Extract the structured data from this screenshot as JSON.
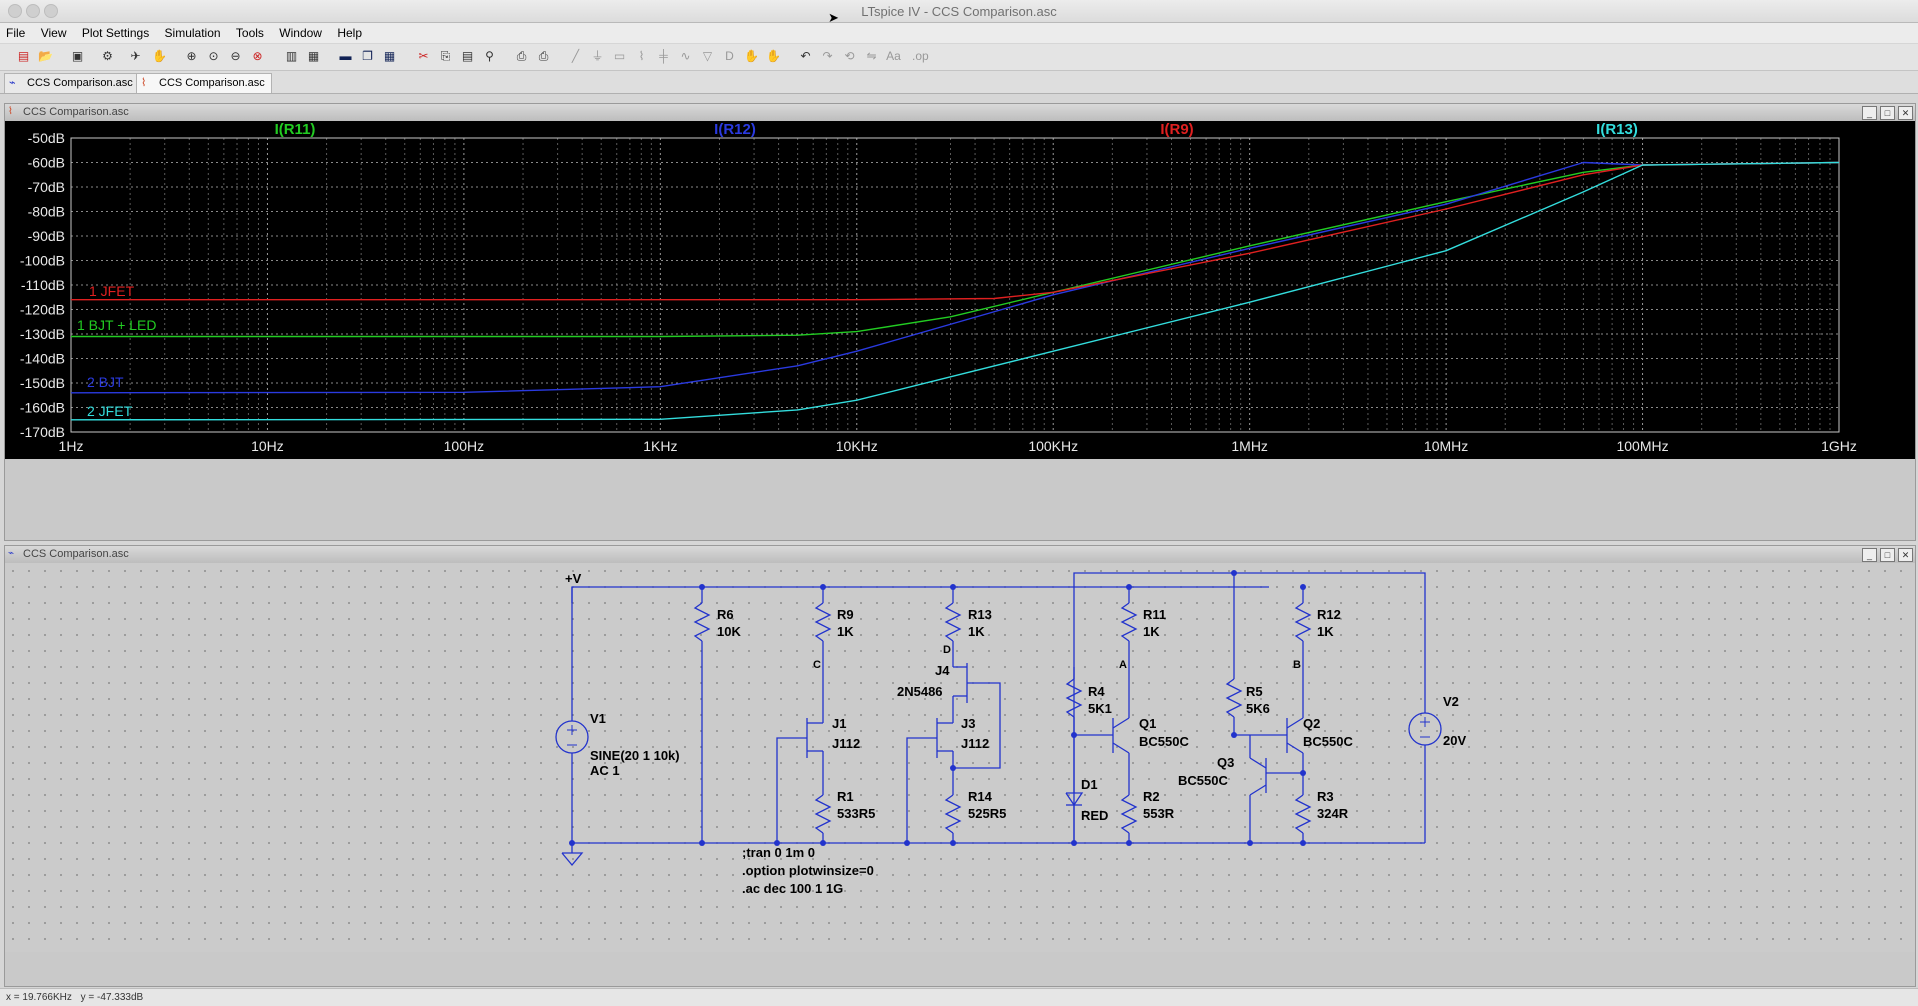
{
  "app": {
    "window_title": "LTspice IV - CCS Comparison.asc"
  },
  "menu": [
    "File",
    "View",
    "Plot Settings",
    "Simulation",
    "Tools",
    "Window",
    "Help"
  ],
  "tabs": [
    {
      "label": "CCS Comparison.asc",
      "icon": "schematic-icon"
    },
    {
      "label": "CCS Comparison.asc",
      "icon": "waveform-icon"
    }
  ],
  "plot_window": {
    "title": "CCS Comparison.asc",
    "traces_header": [
      {
        "label": "I(R11)",
        "color": "#22cc22"
      },
      {
        "label": "I(R12)",
        "color": "#2a3ae0"
      },
      {
        "label": "I(R9)",
        "color": "#e02020"
      },
      {
        "label": "I(R13)",
        "color": "#33dddd"
      }
    ],
    "y_ticks": [
      "-50dB",
      "-60dB",
      "-70dB",
      "-80dB",
      "-90dB",
      "-100dB",
      "-110dB",
      "-120dB",
      "-130dB",
      "-140dB",
      "-150dB",
      "-160dB",
      "-170dB"
    ],
    "x_ticks": [
      "1Hz",
      "10Hz",
      "100Hz",
      "1KHz",
      "10KHz",
      "100KHz",
      "1MHz",
      "10MHz",
      "100MHz",
      "1GHz"
    ],
    "annotations": [
      {
        "text": "1 JFET",
        "color": "#e02020"
      },
      {
        "text": "1 BJT + LED",
        "color": "#22cc22"
      },
      {
        "text": "2 BJT",
        "color": "#2a3ae0"
      },
      {
        "text": "2 JFET",
        "color": "#33dddd"
      }
    ]
  },
  "chart_data": {
    "type": "line",
    "xscale": "log",
    "xlim": [
      1,
      1000000000
    ],
    "ylim": [
      -170,
      -50
    ],
    "xlabel": "",
    "ylabel": "",
    "grid": true,
    "series": [
      {
        "name": "I(R11)",
        "color": "#22cc22",
        "x": [
          1,
          100,
          1000,
          5000,
          10000,
          30000,
          100000,
          1000000,
          10000000,
          50000000,
          100000000,
          1000000000
        ],
        "y": [
          -131,
          -131,
          -131,
          -130.5,
          -129,
          -123,
          -113,
          -94,
          -76,
          -64,
          -61,
          -60
        ]
      },
      {
        "name": "I(R12)",
        "color": "#2a3ae0",
        "x": [
          1,
          100,
          1000,
          5000,
          10000,
          100000,
          1000000,
          10000000,
          50000000,
          100000000,
          1000000000
        ],
        "y": [
          -154,
          -153.8,
          -151.5,
          -143,
          -137,
          -114,
          -95,
          -77,
          -60,
          -61,
          -60
        ]
      },
      {
        "name": "I(R9)",
        "color": "#e02020",
        "x": [
          1,
          1000,
          10000,
          50000,
          100000,
          1000000,
          10000000,
          50000000,
          100000000,
          1000000000
        ],
        "y": [
          -116,
          -116,
          -116,
          -115.5,
          -113,
          -97,
          -79,
          -65,
          -61,
          -60
        ]
      },
      {
        "name": "I(R13)",
        "color": "#33dddd",
        "x": [
          1,
          1000,
          5000,
          10000,
          100000,
          1000000,
          10000000,
          50000000,
          100000000,
          1000000000
        ],
        "y": [
          -165,
          -164.8,
          -161,
          -157,
          -137,
          -117,
          -96,
          -72,
          -61,
          -60
        ]
      }
    ]
  },
  "schematic_window": {
    "title": "CCS Comparison.asc",
    "labels": {
      "vplus": "+V",
      "R6": "R6",
      "R6v": "10K",
      "R9": "R9",
      "R9v": "1K",
      "R13": "R13",
      "R13v": "1K",
      "R11": "R11",
      "R11v": "1K",
      "R12": "R12",
      "R12v": "1K",
      "netC": "C",
      "netD": "D",
      "netA": "A",
      "netB": "B",
      "J4": "J4",
      "J4v": "2N5486",
      "J1": "J1",
      "J1v": "J112",
      "J3": "J3",
      "J3v": "J112",
      "R4": "R4",
      "R4v": "5K1",
      "R5": "R5",
      "R5v": "5K6",
      "Q1": "Q1",
      "Q1v": "BC550C",
      "Q2": "Q2",
      "Q2v": "BC550C",
      "Q3": "Q3",
      "Q3v": "BC550C",
      "V1": "V1",
      "V1v1": "SINE(20 1 10k)",
      "V1v2": "AC 1",
      "V2": "V2",
      "V2v": "20V",
      "R1": "R1",
      "R1v": "533R5",
      "R14": "R14",
      "R14v": "525R5",
      "D1": "D1",
      "D1v": "RED",
      "R2": "R2",
      "R2v": "553R",
      "R3": "R3",
      "R3v": "324R",
      "dir1": ";tran 0 1m 0",
      "dir2": ".option plotwinsize=0",
      "dir3": ".ac dec 100 1 1G"
    }
  },
  "status": {
    "x": "x = 19.766KHz",
    "y": "y = -47.333dB"
  }
}
